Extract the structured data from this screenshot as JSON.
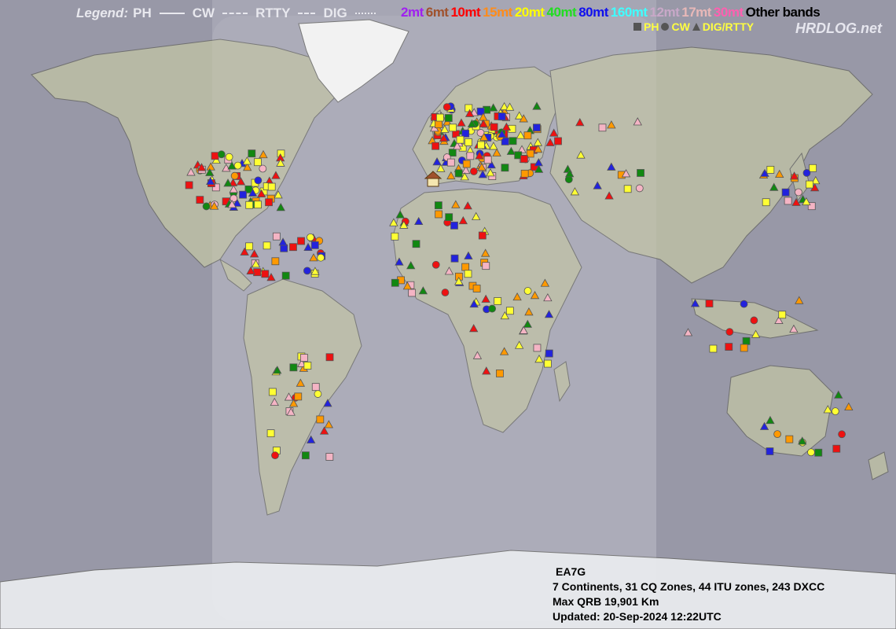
{
  "legend": {
    "title": "Legend:",
    "modes": [
      "PH",
      "CW",
      "RTTY",
      "DIG"
    ]
  },
  "bands": [
    {
      "label": "2mt",
      "color": "#a020f0"
    },
    {
      "label": "6mt",
      "color": "#a0522d"
    },
    {
      "label": "10mt",
      "color": "#ff0000"
    },
    {
      "label": "15mt",
      "color": "#ff8c1a"
    },
    {
      "label": "20mt",
      "color": "#ffff00"
    },
    {
      "label": "40mt",
      "color": "#22dd22"
    },
    {
      "label": "80mt",
      "color": "#1010ee"
    },
    {
      "label": "160mt",
      "color": "#40ffff"
    },
    {
      "label": "12mt",
      "color": "#c8a8c8"
    },
    {
      "label": "17mt",
      "color": "#e8b8b8"
    },
    {
      "label": "30mt",
      "color": "#ff60b0"
    },
    {
      "label": "Other bands",
      "color": "#000000"
    }
  ],
  "symbols": {
    "ph": "PH",
    "cw": "CW",
    "dig": "DIG/RTTY"
  },
  "brand": "HRDLOG.net",
  "stats": {
    "callsign": "EA7G",
    "summary": "7 Continents, 31 CQ Zones, 44 ITU zones, 243 DXCC",
    "max_qrb": "Max QRB 19,901 Km",
    "updated": "Updated: 20-Sep-2024 12:22UTC"
  },
  "colors": {
    "ocean": "#a6a6b4",
    "land": "#b5b8a4",
    "night_overlay": "#6e6e80",
    "antarctica": "#e4e6ea",
    "greenland": "#f2f2f2"
  }
}
